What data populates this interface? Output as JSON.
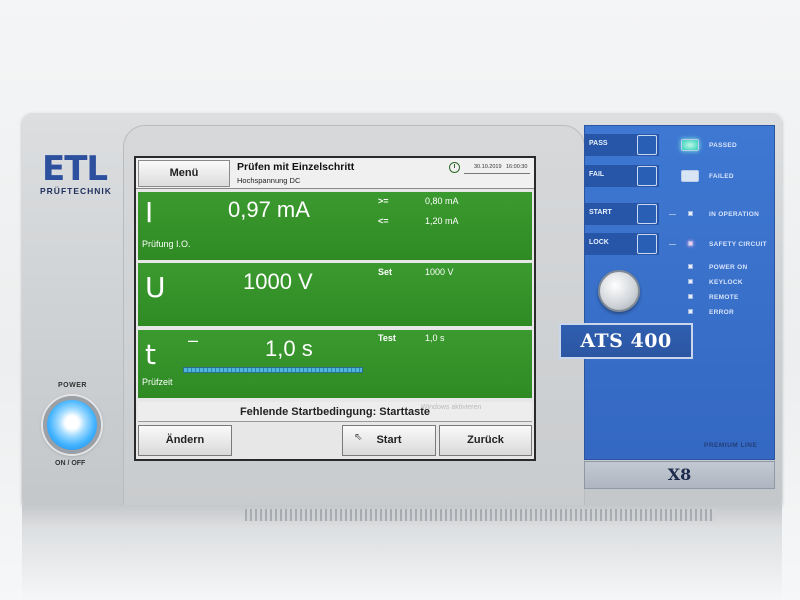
{
  "brand": {
    "logo": "ETL",
    "name": "PRÜFTECHNIK"
  },
  "power": {
    "label": "POWER",
    "state_label": "ON / OFF"
  },
  "screen": {
    "menu_label": "Menü",
    "title": "Prüfen mit Einzelschritt",
    "subtitle": "Hochspannung DC",
    "date": "30.10.2019",
    "time": "16:00:30",
    "current": {
      "symbol": "I",
      "value": "0,97 mA",
      "min_label": ">=",
      "min_value": "0,80 mA",
      "max_label": "<=",
      "max_value": "1,20 mA",
      "status": "Prüfung I.O."
    },
    "voltage": {
      "symbol": "U",
      "value": "1000 V",
      "set_label": "Set",
      "set_value": "1000 V"
    },
    "time_panel": {
      "symbol": "t",
      "dash": "–",
      "value": "1,0 s",
      "test_label": "Test",
      "test_value": "1,0 s",
      "status": "Prüfzeit",
      "progress": 1.0
    },
    "message": "Fehlende Startbedingung: Starttaste",
    "watermark": [
      "Windows aktivieren",
      "Wechseln Sie zu den PC-",
      "Einstellungen, um Windows zu",
      "aktivieren."
    ],
    "buttons": {
      "edit": "Ändern",
      "start": "Start",
      "back": "Zurück"
    }
  },
  "control_panel": {
    "keys": [
      "PASS",
      "FAIL",
      "START",
      "LOCK"
    ],
    "indicators": {
      "passed": "PASSED",
      "failed": "FAILED",
      "in_operation": "IN OPERATION",
      "safety_circuit": "SAFETY CIRCUIT",
      "power_on": "POWER ON",
      "keylock": "KEYLOCK",
      "remote": "REMOTE",
      "error": "ERROR"
    },
    "model": "ATS 400",
    "line": "PREMIUM LINE",
    "variant": "X8"
  }
}
